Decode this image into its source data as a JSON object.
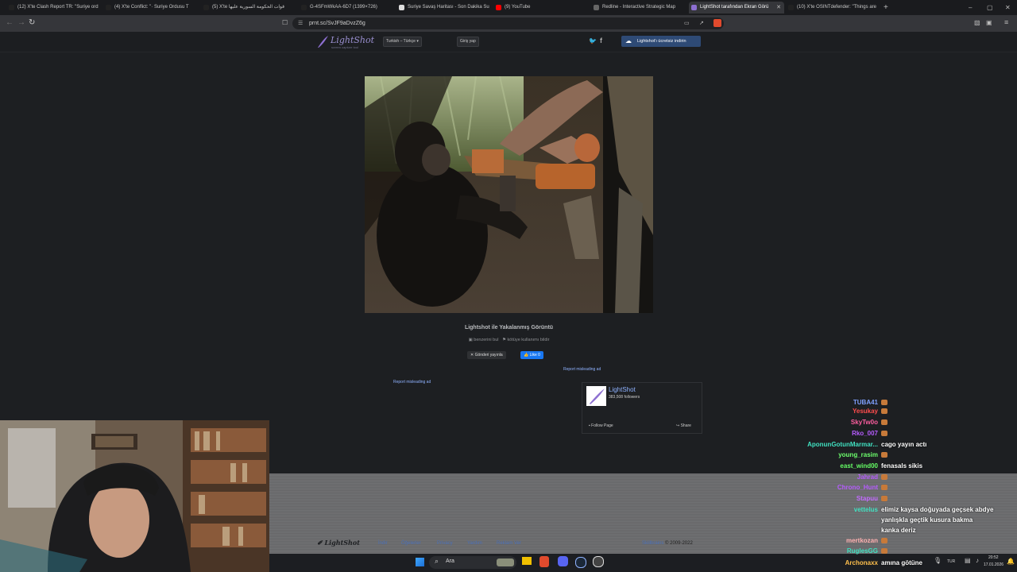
{
  "browser": {
    "tabs": [
      {
        "title": "(12) X'te Clash Report TR: \"Suriye ord",
        "icon_color": "#222",
        "icon": "x-icon",
        "active": false
      },
      {
        "title": "(4) X'te Conflict: \"· Suriye Ordusu T",
        "icon_color": "#222",
        "icon": "x-icon",
        "active": false
      },
      {
        "title": "(5) X'te قوات الحكومة السورية عليها",
        "icon_color": "#222",
        "icon": "x-icon",
        "active": false
      },
      {
        "title": "G-4SFmWkAA-6D7 (1399×726)",
        "icon_color": "#222",
        "icon": "x-icon",
        "active": false
      },
      {
        "title": "Suriye Savaş Haritası - Son Dakika Su",
        "icon_color": "#ddd",
        "icon": "map-icon",
        "active": false
      },
      {
        "title": "(9) YouTube",
        "icon_color": "#ff0000",
        "icon": "youtube-icon",
        "active": false
      },
      {
        "title": "Redline - Interactive Strategic Map",
        "icon_color": "#666",
        "icon": "redline-icon",
        "active": false
      },
      {
        "title": "LightShot tarafından Ekran Görü",
        "icon_color": "#8d6fd1",
        "icon": "lightshot-icon",
        "active": true
      },
      {
        "title": "(10) X'te OSINTdefender: \"Things are",
        "icon_color": "#222",
        "icon": "x-icon",
        "active": false
      }
    ],
    "url": "prnt.sc/SvJF9aDvzZ6g",
    "window_controls": [
      "–",
      "▢",
      "✕"
    ]
  },
  "lightshot": {
    "logo_name": "LightShot",
    "logo_sub": "screen capture tool",
    "language": "Turkish – Türkçe",
    "login": "Giriş yap",
    "download": "Lightshot'ı ücretsiz indirin",
    "caption": "Lightshot ile Yakalanmış Görüntü",
    "find_similar": "benzerini bul",
    "report_usage": "kötüye kullanımı bildir",
    "tweet": "Gönderi yayınla",
    "like": "Like 0",
    "report_ad": "Report misleading ad",
    "report_ad2": "Report misleading ad",
    "fb": {
      "name": "LightShot",
      "followers": "383,508 followers",
      "follow": "Follow Page",
      "share": "Share"
    },
    "footer": {
      "logo": "LightShot",
      "links": [
        "İndir",
        "Öğelerler",
        "Privacy",
        "Yardım",
        "Reklam Ver"
      ],
      "company": "Skillbrains",
      "copyright": "© 2009-2022"
    }
  },
  "taskbar": {
    "search": "Ara",
    "lang": "TUR",
    "time": "20:52",
    "date": "17.01.2026"
  },
  "chat": [
    {
      "user": "TUBA41",
      "color": "#7fa0ff",
      "msg": "",
      "emote": true
    },
    {
      "user": "Yesukay",
      "color": "#ff4d4d",
      "msg": "",
      "emote": true
    },
    {
      "user": "SkyTw0o",
      "color": "#ff5ea0",
      "msg": "",
      "emote": true
    },
    {
      "user": "Rko_007",
      "color": "#b65cff",
      "msg": "",
      "emote": true
    },
    {
      "user": "AponunGotunMarmar...",
      "color": "#40e0c0",
      "msg": "cago yayın actı",
      "emote": false
    },
    {
      "user": "young_rasim",
      "color": "#6dff6d",
      "msg": "",
      "emote": true
    },
    {
      "user": "east_wind00",
      "color": "#66ff66",
      "msg": "fenasals sikis",
      "emote": false
    },
    {
      "user": "Jahrad",
      "color": "#b65cff",
      "msg": "",
      "emote": true
    },
    {
      "user": "Chrono_Hunt",
      "color": "#b65cff",
      "msg": "",
      "emote": true
    },
    {
      "user": "Stapuu",
      "color": "#c36bff",
      "msg": "",
      "emote": true
    },
    {
      "user": "vettelus",
      "color": "#40e0c0",
      "msg": "elimiz kaysa doğuyada geçsek abdye",
      "emote": false
    },
    {
      "user": "",
      "color": "#fff",
      "msg": "yanlışkla geçtik kusura bakma",
      "emote": false
    },
    {
      "user": "",
      "color": "#fff",
      "msg": "kanka deriz",
      "emote": false
    },
    {
      "user": "mertkozan",
      "color": "#ffb0b0",
      "msg": "",
      "emote": true
    },
    {
      "user": "RuglesGG",
      "color": "#40e0c0",
      "msg": "",
      "emote": true
    },
    {
      "user": "Archonaxx",
      "color": "#ffc04d",
      "msg": "amına götüne",
      "emote": false
    }
  ]
}
